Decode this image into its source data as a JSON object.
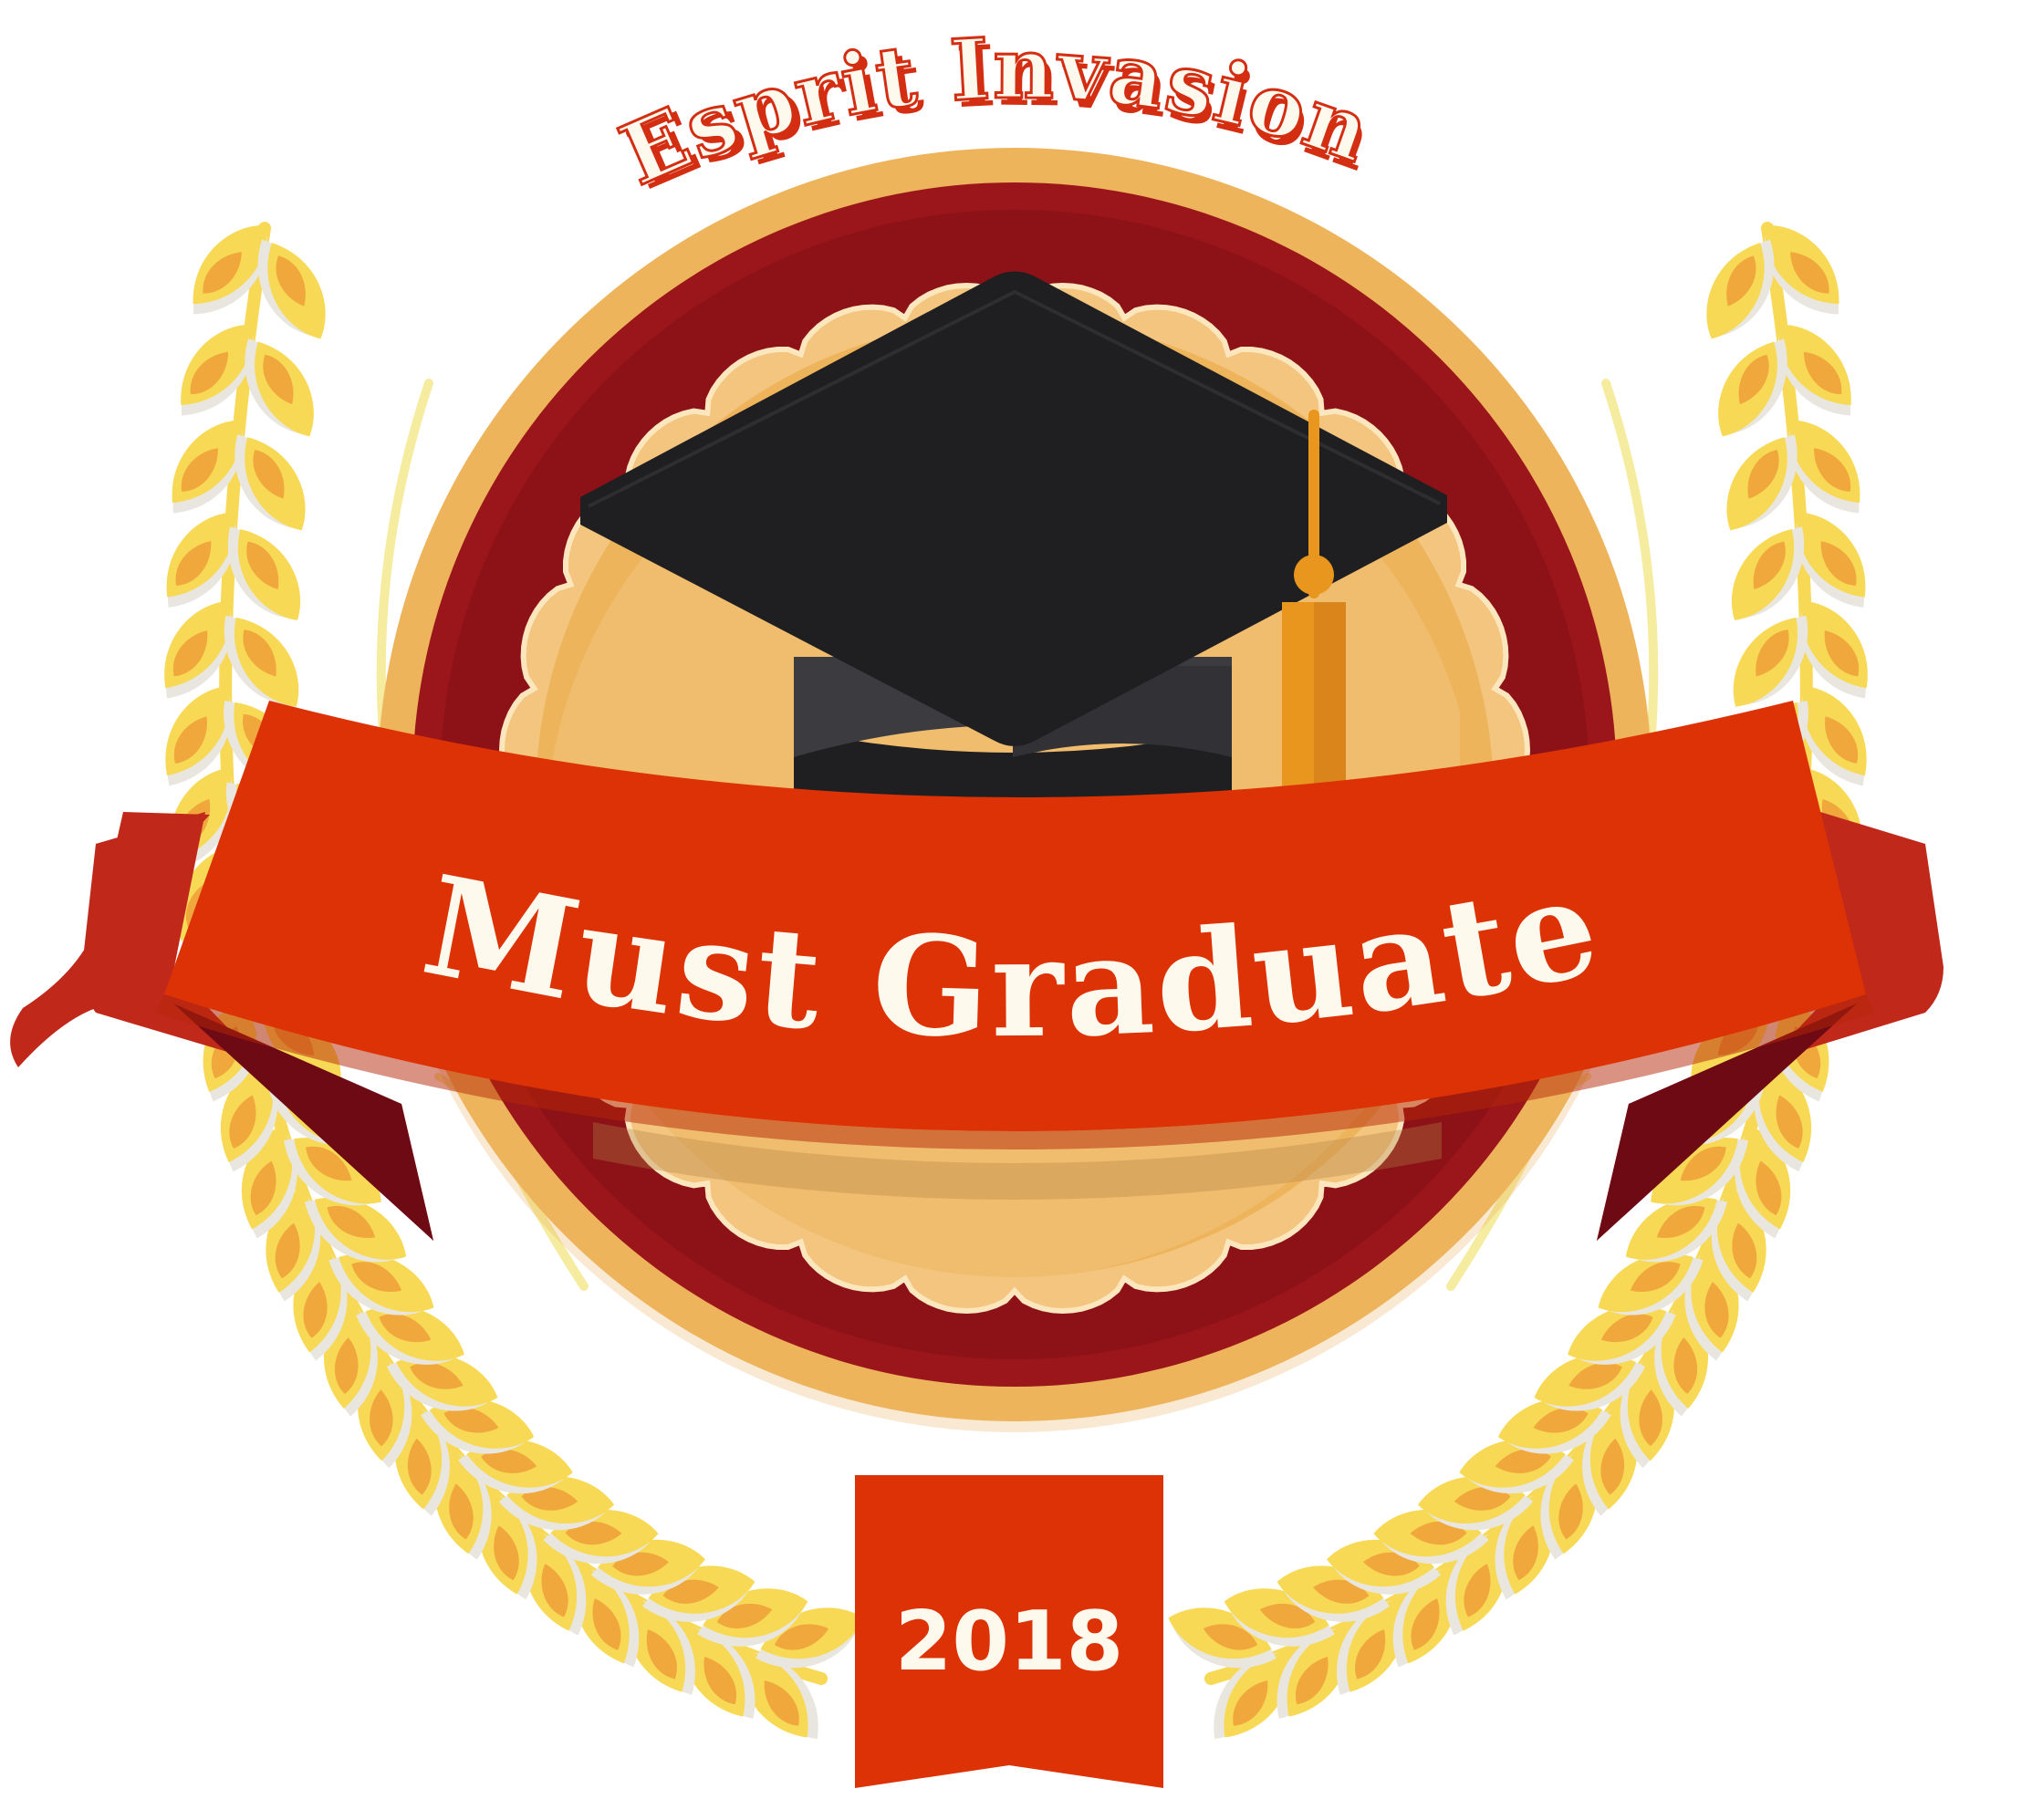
{
  "badge": {
    "arc_text": "Esprit Invasion",
    "banner_text": "Must Graduate",
    "year": "2018"
  },
  "icons": {
    "cap": "graduation-cap-icon",
    "laurel_left": "laurel-branch-icon",
    "laurel_right": "laurel-branch-icon"
  },
  "colors": {
    "banner_red": "#dc3205",
    "ribbon_tail": "#c0281a",
    "ribbon_shadow": "#6e0a14",
    "ring_dark_red": "#9a161a",
    "ring_gold": "#eeb45c",
    "inner_gold": "#f3c57e",
    "laurel_yellow": "#f7d955",
    "laurel_orange": "#f0a83c",
    "cap_black": "#1f1f21",
    "tassel": "#e8961e",
    "text_cream": "#fdf9ec",
    "arc_text_shadow": "#d42e12"
  }
}
